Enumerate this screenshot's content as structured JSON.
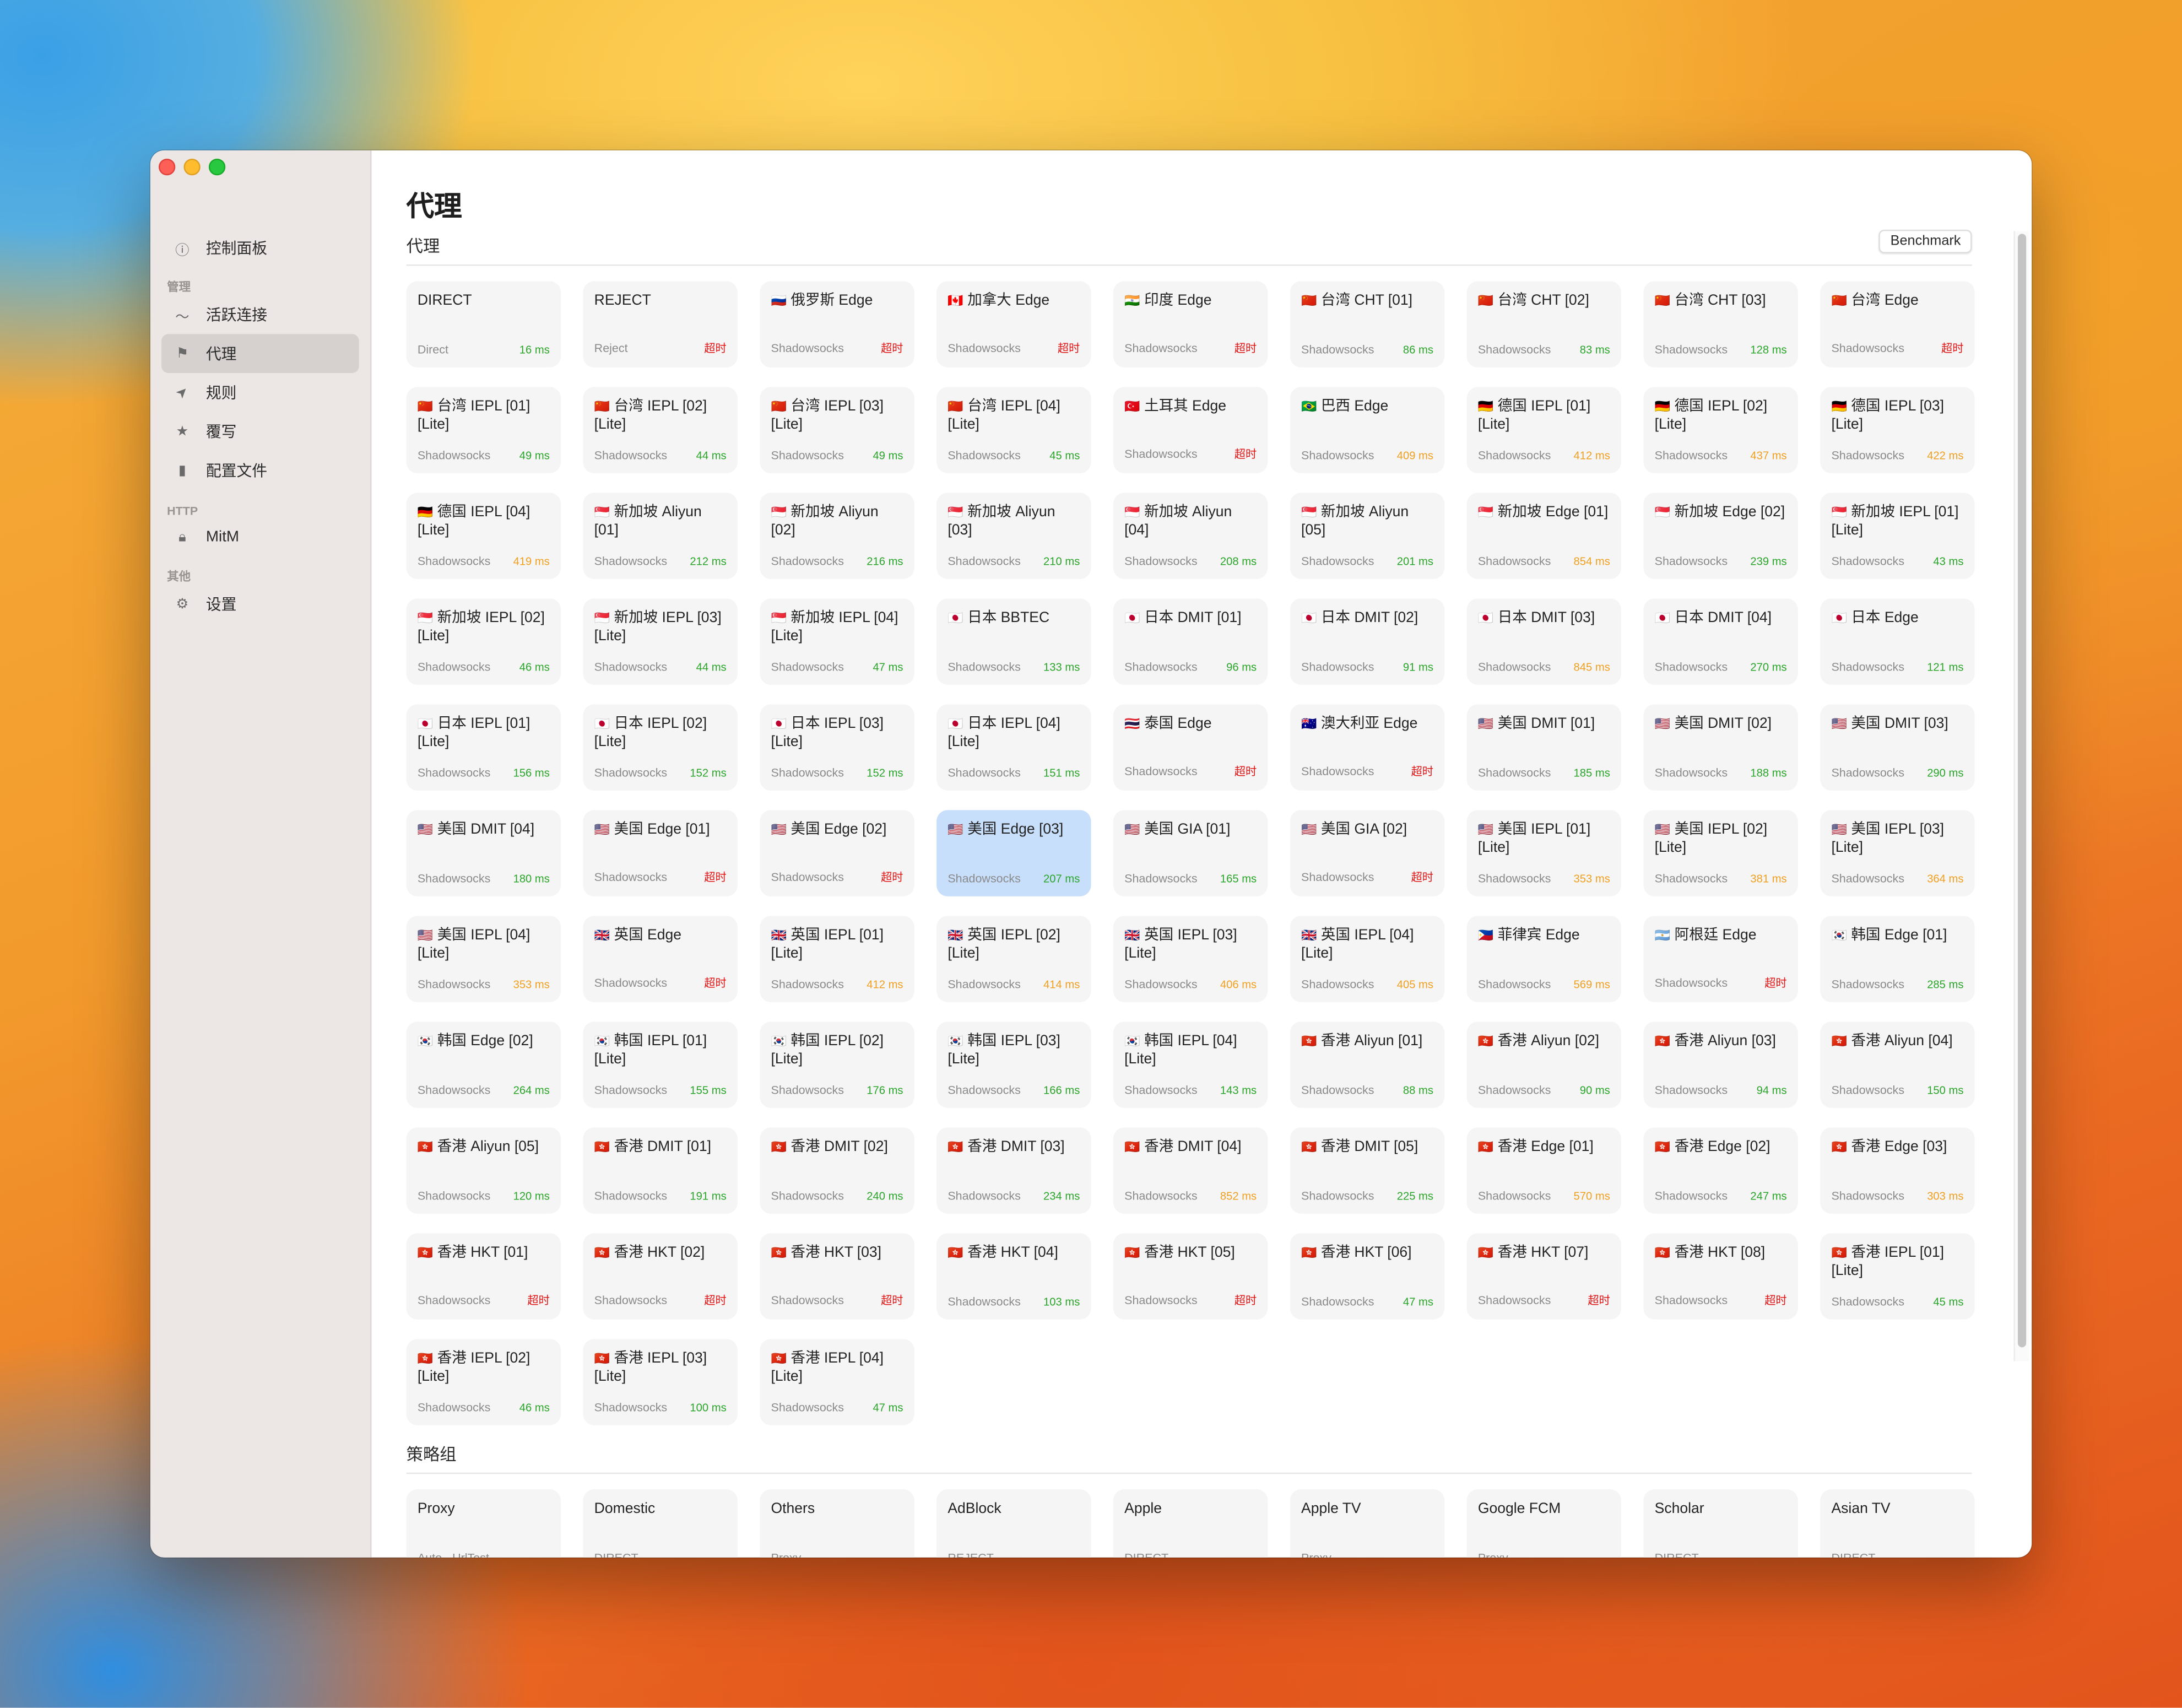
{
  "window": {
    "controls": [
      "close",
      "minimize",
      "maximize"
    ]
  },
  "sidebar": {
    "items": [
      {
        "id": "dashboard",
        "label": "控制面板",
        "icon": "gauge-icon"
      },
      {
        "section": "管理"
      },
      {
        "id": "connections",
        "label": "活跃连接",
        "icon": "activity-icon"
      },
      {
        "id": "proxy",
        "label": "代理",
        "icon": "flag-icon",
        "active": true
      },
      {
        "id": "rules",
        "label": "规则",
        "icon": "location-arrow-icon"
      },
      {
        "id": "rewrite",
        "label": "覆写",
        "icon": "star-icon"
      },
      {
        "id": "profiles",
        "label": "配置文件",
        "icon": "document-icon"
      },
      {
        "section": "HTTP"
      },
      {
        "id": "mitm",
        "label": "MitM",
        "icon": "lock-icon"
      },
      {
        "section": "其他"
      },
      {
        "id": "settings",
        "label": "设置",
        "icon": "gear-icon"
      }
    ]
  },
  "main": {
    "title": "代理",
    "proxy_section": {
      "label": "代理",
      "benchmark_label": "Benchmark",
      "cards": [
        {
          "flag": "",
          "name": "DIRECT",
          "type": "Direct",
          "latency": "16 ms",
          "status": "good"
        },
        {
          "flag": "",
          "name": "REJECT",
          "type": "Reject",
          "latency": "超时",
          "status": "bad"
        },
        {
          "flag": "🇷🇺",
          "name": "俄罗斯 Edge",
          "type": "Shadowsocks",
          "latency": "超时",
          "status": "bad"
        },
        {
          "flag": "🇨🇦",
          "name": "加拿大 Edge",
          "type": "Shadowsocks",
          "latency": "超时",
          "status": "bad"
        },
        {
          "flag": "🇮🇳",
          "name": "印度 Edge",
          "type": "Shadowsocks",
          "latency": "超时",
          "status": "bad"
        },
        {
          "flag": "🇨🇳",
          "name": "台湾 CHT [01]",
          "type": "Shadowsocks",
          "latency": "86 ms",
          "status": "good"
        },
        {
          "flag": "🇨🇳",
          "name": "台湾 CHT [02]",
          "type": "Shadowsocks",
          "latency": "83 ms",
          "status": "good"
        },
        {
          "flag": "🇨🇳",
          "name": "台湾 CHT [03]",
          "type": "Shadowsocks",
          "latency": "128 ms",
          "status": "good"
        },
        {
          "flag": "🇨🇳",
          "name": "台湾 Edge",
          "type": "Shadowsocks",
          "latency": "超时",
          "status": "bad"
        },
        {
          "flag": "🇨🇳",
          "name": "台湾 IEPL [01] [Lite]",
          "type": "Shadowsocks",
          "latency": "49 ms",
          "status": "good"
        },
        {
          "flag": "🇨🇳",
          "name": "台湾 IEPL [02] [Lite]",
          "type": "Shadowsocks",
          "latency": "44 ms",
          "status": "good"
        },
        {
          "flag": "🇨🇳",
          "name": "台湾 IEPL [03] [Lite]",
          "type": "Shadowsocks",
          "latency": "49 ms",
          "status": "good"
        },
        {
          "flag": "🇨🇳",
          "name": "台湾 IEPL [04] [Lite]",
          "type": "Shadowsocks",
          "latency": "45 ms",
          "status": "good"
        },
        {
          "flag": "🇹🇷",
          "name": "土耳其 Edge",
          "type": "Shadowsocks",
          "latency": "超时",
          "status": "bad"
        },
        {
          "flag": "🇧🇷",
          "name": "巴西 Edge",
          "type": "Shadowsocks",
          "latency": "409 ms",
          "status": "mid"
        },
        {
          "flag": "🇩🇪",
          "name": "德国 IEPL [01] [Lite]",
          "type": "Shadowsocks",
          "latency": "412 ms",
          "status": "mid"
        },
        {
          "flag": "🇩🇪",
          "name": "德国 IEPL [02] [Lite]",
          "type": "Shadowsocks",
          "latency": "437 ms",
          "status": "mid"
        },
        {
          "flag": "🇩🇪",
          "name": "德国 IEPL [03] [Lite]",
          "type": "Shadowsocks",
          "latency": "422 ms",
          "status": "mid"
        },
        {
          "flag": "🇩🇪",
          "name": "德国 IEPL [04] [Lite]",
          "type": "Shadowsocks",
          "latency": "419 ms",
          "status": "mid"
        },
        {
          "flag": "🇸🇬",
          "name": "新加坡 Aliyun [01]",
          "type": "Shadowsocks",
          "latency": "212 ms",
          "status": "good"
        },
        {
          "flag": "🇸🇬",
          "name": "新加坡 Aliyun [02]",
          "type": "Shadowsocks",
          "latency": "216 ms",
          "status": "good"
        },
        {
          "flag": "🇸🇬",
          "name": "新加坡 Aliyun [03]",
          "type": "Shadowsocks",
          "latency": "210 ms",
          "status": "good"
        },
        {
          "flag": "🇸🇬",
          "name": "新加坡 Aliyun [04]",
          "type": "Shadowsocks",
          "latency": "208 ms",
          "status": "good"
        },
        {
          "flag": "🇸🇬",
          "name": "新加坡 Aliyun [05]",
          "type": "Shadowsocks",
          "latency": "201 ms",
          "status": "good"
        },
        {
          "flag": "🇸🇬",
          "name": "新加坡 Edge [01]",
          "type": "Shadowsocks",
          "latency": "854 ms",
          "status": "mid"
        },
        {
          "flag": "🇸🇬",
          "name": "新加坡 Edge [02]",
          "type": "Shadowsocks",
          "latency": "239 ms",
          "status": "good"
        },
        {
          "flag": "🇸🇬",
          "name": "新加坡 IEPL [01] [Lite]",
          "type": "Shadowsocks",
          "latency": "43 ms",
          "status": "good"
        },
        {
          "flag": "🇸🇬",
          "name": "新加坡 IEPL [02] [Lite]",
          "type": "Shadowsocks",
          "latency": "46 ms",
          "status": "good"
        },
        {
          "flag": "🇸🇬",
          "name": "新加坡 IEPL [03] [Lite]",
          "type": "Shadowsocks",
          "latency": "44 ms",
          "status": "good"
        },
        {
          "flag": "🇸🇬",
          "name": "新加坡 IEPL [04] [Lite]",
          "type": "Shadowsocks",
          "latency": "47 ms",
          "status": "good"
        },
        {
          "flag": "🇯🇵",
          "name": "日本 BBTEC",
          "type": "Shadowsocks",
          "latency": "133 ms",
          "status": "good"
        },
        {
          "flag": "🇯🇵",
          "name": "日本 DMIT [01]",
          "type": "Shadowsocks",
          "latency": "96 ms",
          "status": "good"
        },
        {
          "flag": "🇯🇵",
          "name": "日本 DMIT [02]",
          "type": "Shadowsocks",
          "latency": "91 ms",
          "status": "good"
        },
        {
          "flag": "🇯🇵",
          "name": "日本 DMIT [03]",
          "type": "Shadowsocks",
          "latency": "845 ms",
          "status": "mid"
        },
        {
          "flag": "🇯🇵",
          "name": "日本 DMIT [04]",
          "type": "Shadowsocks",
          "latency": "270 ms",
          "status": "good"
        },
        {
          "flag": "🇯🇵",
          "name": "日本 Edge",
          "type": "Shadowsocks",
          "latency": "121 ms",
          "status": "good"
        },
        {
          "flag": "🇯🇵",
          "name": "日本 IEPL [01] [Lite]",
          "type": "Shadowsocks",
          "latency": "156 ms",
          "status": "good"
        },
        {
          "flag": "🇯🇵",
          "name": "日本 IEPL [02] [Lite]",
          "type": "Shadowsocks",
          "latency": "152 ms",
          "status": "good"
        },
        {
          "flag": "🇯🇵",
          "name": "日本 IEPL [03] [Lite]",
          "type": "Shadowsocks",
          "latency": "152 ms",
          "status": "good"
        },
        {
          "flag": "🇯🇵",
          "name": "日本 IEPL [04] [Lite]",
          "type": "Shadowsocks",
          "latency": "151 ms",
          "status": "good"
        },
        {
          "flag": "🇹🇭",
          "name": "泰国 Edge",
          "type": "Shadowsocks",
          "latency": "超时",
          "status": "bad"
        },
        {
          "flag": "🇦🇺",
          "name": "澳大利亚 Edge",
          "type": "Shadowsocks",
          "latency": "超时",
          "status": "bad"
        },
        {
          "flag": "🇺🇸",
          "name": "美国 DMIT [01]",
          "type": "Shadowsocks",
          "latency": "185 ms",
          "status": "good"
        },
        {
          "flag": "🇺🇸",
          "name": "美国 DMIT [02]",
          "type": "Shadowsocks",
          "latency": "188 ms",
          "status": "good"
        },
        {
          "flag": "🇺🇸",
          "name": "美国 DMIT [03]",
          "type": "Shadowsocks",
          "latency": "290 ms",
          "status": "good"
        },
        {
          "flag": "🇺🇸",
          "name": "美国 DMIT [04]",
          "type": "Shadowsocks",
          "latency": "180 ms",
          "status": "good"
        },
        {
          "flag": "🇺🇸",
          "name": "美国 Edge [01]",
          "type": "Shadowsocks",
          "latency": "超时",
          "status": "bad"
        },
        {
          "flag": "🇺🇸",
          "name": "美国 Edge [02]",
          "type": "Shadowsocks",
          "latency": "超时",
          "status": "bad"
        },
        {
          "flag": "🇺🇸",
          "name": "美国 Edge [03]",
          "type": "Shadowsocks",
          "latency": "207 ms",
          "status": "good",
          "selected": true
        },
        {
          "flag": "🇺🇸",
          "name": "美国 GIA [01]",
          "type": "Shadowsocks",
          "latency": "165 ms",
          "status": "good"
        },
        {
          "flag": "🇺🇸",
          "name": "美国 GIA [02]",
          "type": "Shadowsocks",
          "latency": "超时",
          "status": "bad"
        },
        {
          "flag": "🇺🇸",
          "name": "美国 IEPL [01] [Lite]",
          "type": "Shadowsocks",
          "latency": "353 ms",
          "status": "mid"
        },
        {
          "flag": "🇺🇸",
          "name": "美国 IEPL [02] [Lite]",
          "type": "Shadowsocks",
          "latency": "381 ms",
          "status": "mid"
        },
        {
          "flag": "🇺🇸",
          "name": "美国 IEPL [03] [Lite]",
          "type": "Shadowsocks",
          "latency": "364 ms",
          "status": "mid"
        },
        {
          "flag": "🇺🇸",
          "name": "美国 IEPL [04] [Lite]",
          "type": "Shadowsocks",
          "latency": "353 ms",
          "status": "mid"
        },
        {
          "flag": "🇬🇧",
          "name": "英国 Edge",
          "type": "Shadowsocks",
          "latency": "超时",
          "status": "bad"
        },
        {
          "flag": "🇬🇧",
          "name": "英国 IEPL [01] [Lite]",
          "type": "Shadowsocks",
          "latency": "412 ms",
          "status": "mid"
        },
        {
          "flag": "🇬🇧",
          "name": "英国 IEPL [02] [Lite]",
          "type": "Shadowsocks",
          "latency": "414 ms",
          "status": "mid"
        },
        {
          "flag": "🇬🇧",
          "name": "英国 IEPL [03] [Lite]",
          "type": "Shadowsocks",
          "latency": "406 ms",
          "status": "mid"
        },
        {
          "flag": "🇬🇧",
          "name": "英国 IEPL [04] [Lite]",
          "type": "Shadowsocks",
          "latency": "405 ms",
          "status": "mid"
        },
        {
          "flag": "🇵🇭",
          "name": "菲律宾 Edge",
          "type": "Shadowsocks",
          "latency": "569 ms",
          "status": "mid"
        },
        {
          "flag": "🇦🇷",
          "name": "阿根廷 Edge",
          "type": "Shadowsocks",
          "latency": "超时",
          "status": "bad"
        },
        {
          "flag": "🇰🇷",
          "name": "韩国 Edge [01]",
          "type": "Shadowsocks",
          "latency": "285 ms",
          "status": "good"
        },
        {
          "flag": "🇰🇷",
          "name": "韩国 Edge [02]",
          "type": "Shadowsocks",
          "latency": "264 ms",
          "status": "good"
        },
        {
          "flag": "🇰🇷",
          "name": "韩国 IEPL [01] [Lite]",
          "type": "Shadowsocks",
          "latency": "155 ms",
          "status": "good"
        },
        {
          "flag": "🇰🇷",
          "name": "韩国 IEPL [02] [Lite]",
          "type": "Shadowsocks",
          "latency": "176 ms",
          "status": "good"
        },
        {
          "flag": "🇰🇷",
          "name": "韩国 IEPL [03] [Lite]",
          "type": "Shadowsocks",
          "latency": "166 ms",
          "status": "good"
        },
        {
          "flag": "🇰🇷",
          "name": "韩国 IEPL [04] [Lite]",
          "type": "Shadowsocks",
          "latency": "143 ms",
          "status": "good"
        },
        {
          "flag": "🇭🇰",
          "name": "香港 Aliyun [01]",
          "type": "Shadowsocks",
          "latency": "88 ms",
          "status": "good"
        },
        {
          "flag": "🇭🇰",
          "name": "香港 Aliyun [02]",
          "type": "Shadowsocks",
          "latency": "90 ms",
          "status": "good"
        },
        {
          "flag": "🇭🇰",
          "name": "香港 Aliyun [03]",
          "type": "Shadowsocks",
          "latency": "94 ms",
          "status": "good"
        },
        {
          "flag": "🇭🇰",
          "name": "香港 Aliyun [04]",
          "type": "Shadowsocks",
          "latency": "150 ms",
          "status": "good"
        },
        {
          "flag": "🇭🇰",
          "name": "香港 Aliyun [05]",
          "type": "Shadowsocks",
          "latency": "120 ms",
          "status": "good"
        },
        {
          "flag": "🇭🇰",
          "name": "香港 DMIT [01]",
          "type": "Shadowsocks",
          "latency": "191 ms",
          "status": "good"
        },
        {
          "flag": "🇭🇰",
          "name": "香港 DMIT [02]",
          "type": "Shadowsocks",
          "latency": "240 ms",
          "status": "good"
        },
        {
          "flag": "🇭🇰",
          "name": "香港 DMIT [03]",
          "type": "Shadowsocks",
          "latency": "234 ms",
          "status": "good"
        },
        {
          "flag": "🇭🇰",
          "name": "香港 DMIT [04]",
          "type": "Shadowsocks",
          "latency": "852 ms",
          "status": "mid"
        },
        {
          "flag": "🇭🇰",
          "name": "香港 DMIT [05]",
          "type": "Shadowsocks",
          "latency": "225 ms",
          "status": "good"
        },
        {
          "flag": "🇭🇰",
          "name": "香港 Edge [01]",
          "type": "Shadowsocks",
          "latency": "570 ms",
          "status": "mid"
        },
        {
          "flag": "🇭🇰",
          "name": "香港 Edge [02]",
          "type": "Shadowsocks",
          "latency": "247 ms",
          "status": "good"
        },
        {
          "flag": "🇭🇰",
          "name": "香港 Edge [03]",
          "type": "Shadowsocks",
          "latency": "303 ms",
          "status": "mid"
        },
        {
          "flag": "🇭🇰",
          "name": "香港 HKT [01]",
          "type": "Shadowsocks",
          "latency": "超时",
          "status": "bad"
        },
        {
          "flag": "🇭🇰",
          "name": "香港 HKT [02]",
          "type": "Shadowsocks",
          "latency": "超时",
          "status": "bad"
        },
        {
          "flag": "🇭🇰",
          "name": "香港 HKT [03]",
          "type": "Shadowsocks",
          "latency": "超时",
          "status": "bad"
        },
        {
          "flag": "🇭🇰",
          "name": "香港 HKT [04]",
          "type": "Shadowsocks",
          "latency": "103 ms",
          "status": "good"
        },
        {
          "flag": "🇭🇰",
          "name": "香港 HKT [05]",
          "type": "Shadowsocks",
          "latency": "超时",
          "status": "bad"
        },
        {
          "flag": "🇭🇰",
          "name": "香港 HKT [06]",
          "type": "Shadowsocks",
          "latency": "47 ms",
          "status": "good"
        },
        {
          "flag": "🇭🇰",
          "name": "香港 HKT [07]",
          "type": "Shadowsocks",
          "latency": "超时",
          "status": "bad"
        },
        {
          "flag": "🇭🇰",
          "name": "香港 HKT [08]",
          "type": "Shadowsocks",
          "latency": "超时",
          "status": "bad"
        },
        {
          "flag": "🇭🇰",
          "name": "香港 IEPL [01] [Lite]",
          "type": "Shadowsocks",
          "latency": "45 ms",
          "status": "good"
        },
        {
          "flag": "🇭🇰",
          "name": "香港 IEPL [02] [Lite]",
          "type": "Shadowsocks",
          "latency": "46 ms",
          "status": "good"
        },
        {
          "flag": "🇭🇰",
          "name": "香港 IEPL [03] [Lite]",
          "type": "Shadowsocks",
          "latency": "100 ms",
          "status": "good"
        },
        {
          "flag": "🇭🇰",
          "name": "香港 IEPL [04] [Lite]",
          "type": "Shadowsocks",
          "latency": "47 ms",
          "status": "good"
        }
      ]
    },
    "policy_section": {
      "label": "策略组",
      "cards": [
        {
          "name": "Proxy",
          "type": "Auto - UrlTest"
        },
        {
          "name": "Domestic",
          "type": "DIRECT"
        },
        {
          "name": "Others",
          "type": "Proxy"
        },
        {
          "name": "AdBlock",
          "type": "REJECT"
        },
        {
          "name": "Apple",
          "type": "DIRECT"
        },
        {
          "name": "Apple TV",
          "type": "Proxy"
        },
        {
          "name": "Google FCM",
          "type": "Proxy"
        },
        {
          "name": "Scholar",
          "type": "DIRECT"
        },
        {
          "name": "Asian TV",
          "type": "DIRECT"
        }
      ]
    }
  },
  "colors": {
    "latency_good": "#2aa52a",
    "latency_mid": "#f0a020",
    "latency_bad": "#e01616",
    "selected_card": "#c8dffc",
    "card_bg": "#f5f5f5",
    "sidebar_bg": "#ece7e5",
    "sidebar_active": "#d6d1cf"
  }
}
